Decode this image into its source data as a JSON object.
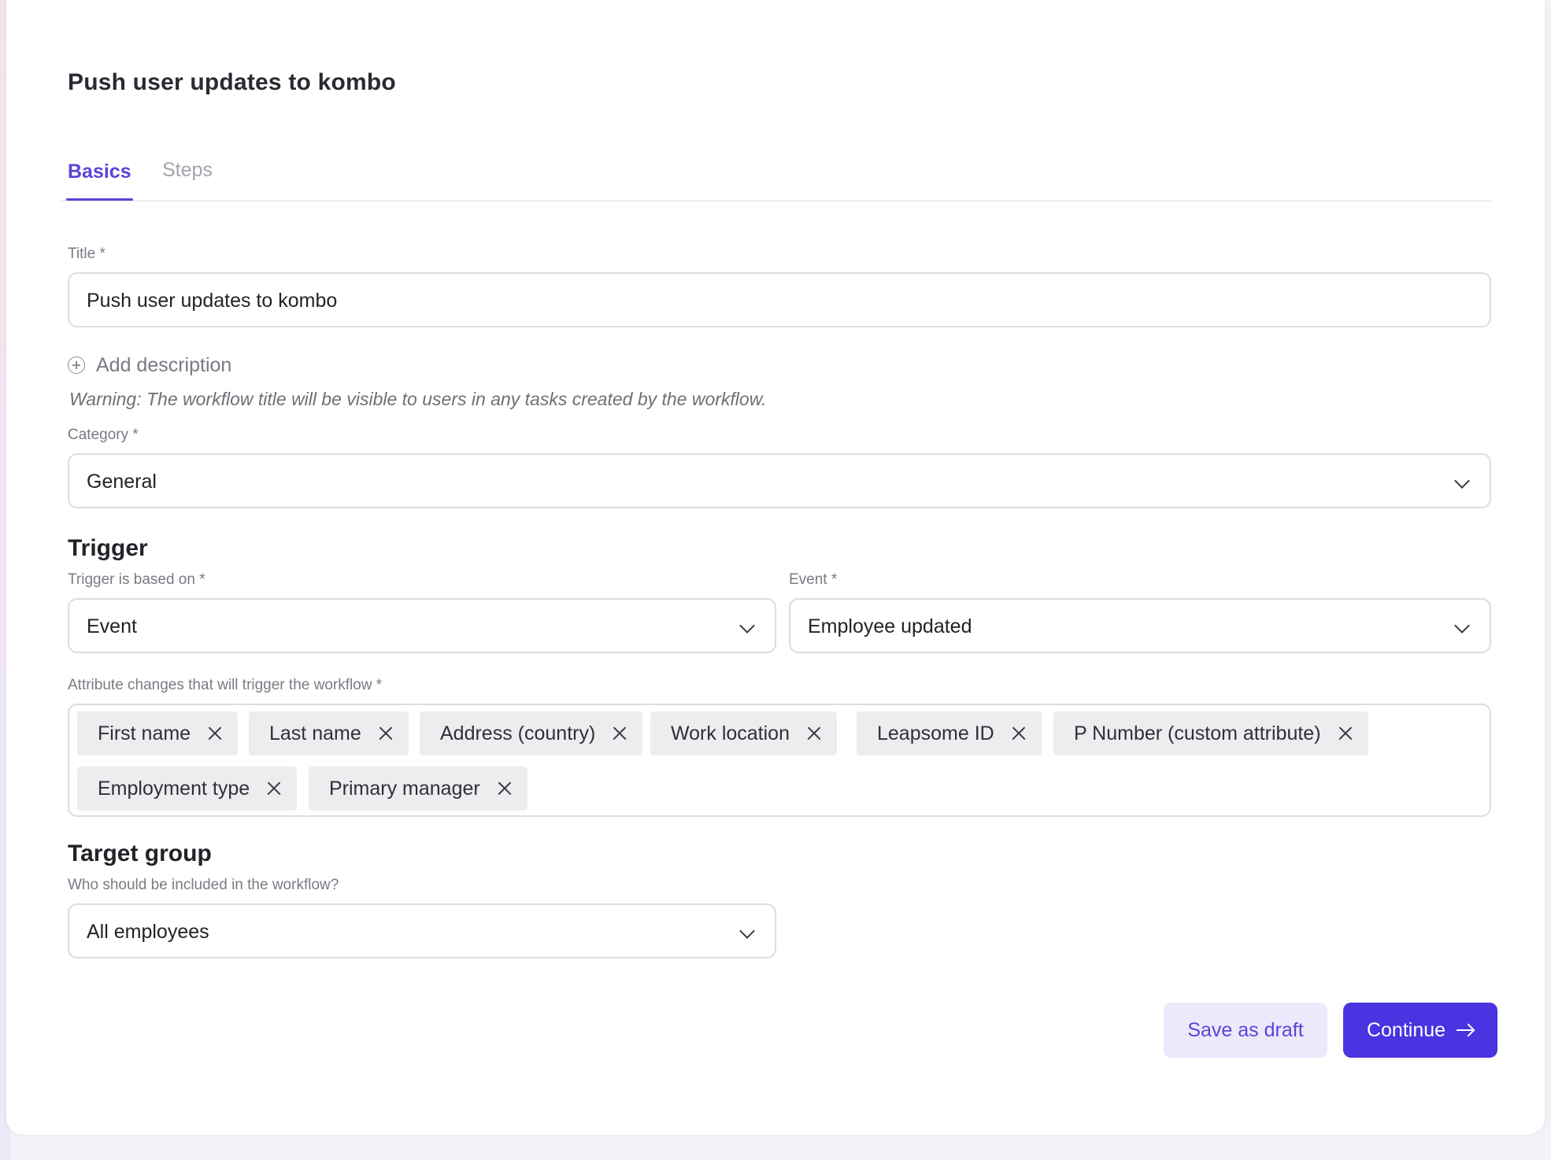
{
  "page": {
    "title": "Push user updates to kombo"
  },
  "tabs": [
    {
      "label": "Basics",
      "active": true
    },
    {
      "label": "Steps",
      "active": false
    }
  ],
  "title_field": {
    "label": "Title *",
    "value": "Push user updates to kombo"
  },
  "description": {
    "add_label": "Add description",
    "warning": "Warning: The workflow title will be visible to users in any tasks created by the workflow."
  },
  "category": {
    "label": "Category *",
    "value": "General"
  },
  "trigger": {
    "section_title": "Trigger",
    "based_on_label": "Trigger is based on *",
    "based_on_value": "Event",
    "event_label": "Event *",
    "event_value": "Employee updated",
    "attributes_label": "Attribute changes that will trigger the workflow *",
    "attributes": [
      "First name",
      "Last name",
      "Address (country)",
      "Work location",
      "Leapsome ID",
      "P Number (custom attribute)",
      "Employment type",
      "Primary manager"
    ]
  },
  "target_group": {
    "section_title": "Target group",
    "label": "Who should be included in the workflow?",
    "value": "All employees"
  },
  "actions": {
    "save_draft": "Save as draft",
    "continue": "Continue"
  },
  "colors": {
    "accent": "#5a44d8",
    "primary_button": "#4a33e0",
    "secondary_button_bg": "#ebe9fb",
    "chip_bg": "#ededf0",
    "border": "#dcdce2"
  },
  "icons": {
    "add": "plus-circle-icon",
    "dropdown": "chevron-down-icon",
    "remove": "close-icon",
    "continue": "arrow-right-icon"
  }
}
